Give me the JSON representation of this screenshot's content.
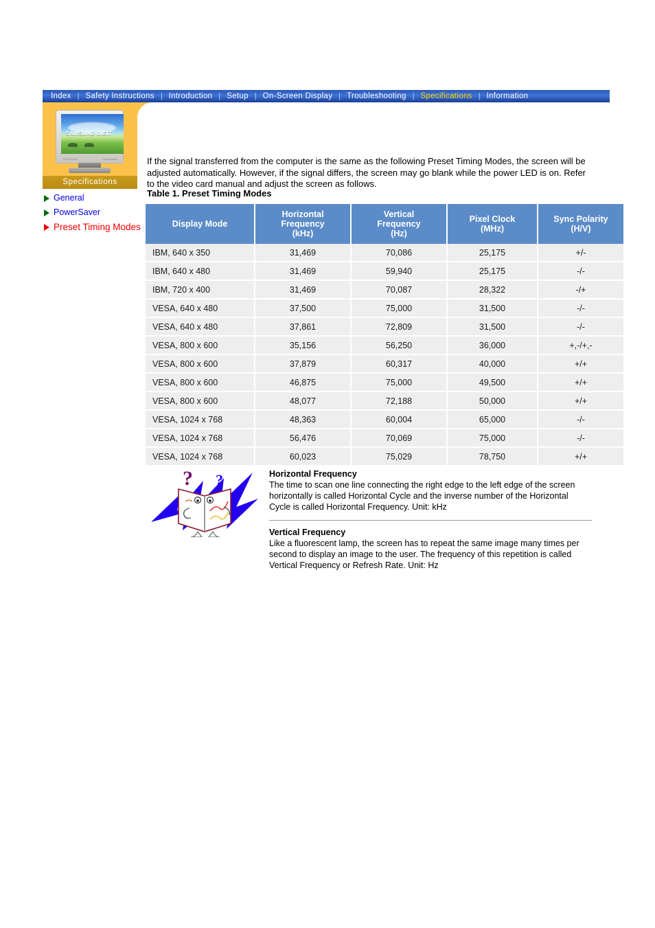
{
  "nav": {
    "items": [
      {
        "label": "Index",
        "active": false
      },
      {
        "label": "Safety Instructions",
        "active": false
      },
      {
        "label": "Introduction",
        "active": false
      },
      {
        "label": "Setup",
        "active": false
      },
      {
        "label": "On-Screen Display",
        "active": false
      },
      {
        "label": "Troubleshooting",
        "active": false
      },
      {
        "label": "Specifications",
        "active": true
      },
      {
        "label": "Information",
        "active": false
      }
    ],
    "separator": "|",
    "active_color": "#ffd500",
    "bar_color": "#3f74d8"
  },
  "sidebar": {
    "section_label": "Specifications",
    "thumbnail": {
      "screen_text": "SAMSUNG DIGIT",
      "brand_text": "SAMSUNG",
      "model_text": "SyncMaster"
    },
    "links": [
      {
        "label": "General",
        "current": false
      },
      {
        "label": "PowerSaver",
        "current": false
      },
      {
        "label": "Preset Timing Modes",
        "current": true
      }
    ],
    "link_color": "#0000e0",
    "current_color": "#ee0000",
    "panel_color": "#fbc24a",
    "label_band_color": "#b98c15"
  },
  "main": {
    "intro": "If the signal transferred from the computer is the same as the following Preset Timing Modes, the screen will be adjusted automatically. However, if the signal differs, the screen may go blank while the power LED is on. Refer to the video card manual and adjust the screen as follows.",
    "table_caption": "Table 1. Preset Timing Modes",
    "table": {
      "header_color": "#5b8cc8",
      "row_color": "#eeeeee",
      "columns": [
        "Display Mode",
        "Horizontal Frequency (kHz)",
        "Vertical Frequency (Hz)",
        "Pixel Clock (MHz)",
        "Sync Polarity (H/V)"
      ],
      "columns_lines": [
        [
          "Display Mode"
        ],
        [
          "Horizontal",
          "Frequency",
          "(kHz)"
        ],
        [
          "Vertical",
          "Frequency",
          "(Hz)"
        ],
        [
          "Pixel Clock",
          "(MHz)"
        ],
        [
          "Sync Polarity",
          "(H/V)"
        ]
      ],
      "rows": [
        {
          "mode": "IBM, 640 x 350",
          "hfreq": "31,469",
          "vfreq": "70,086",
          "pclock": "25,175",
          "sync": "+/-"
        },
        {
          "mode": "IBM, 640 x 480",
          "hfreq": "31,469",
          "vfreq": "59,940",
          "pclock": "25,175",
          "sync": "-/-"
        },
        {
          "mode": "IBM, 720 x 400",
          "hfreq": "31,469",
          "vfreq": "70,087",
          "pclock": "28,322",
          "sync": "-/+"
        },
        {
          "mode": "VESA, 640 x 480",
          "hfreq": "37,500",
          "vfreq": "75,000",
          "pclock": "31,500",
          "sync": "-/-"
        },
        {
          "mode": "VESA, 640 x 480",
          "hfreq": "37,861",
          "vfreq": "72,809",
          "pclock": "31,500",
          "sync": "-/-"
        },
        {
          "mode": "VESA, 800 x 600",
          "hfreq": "35,156",
          "vfreq": "56,250",
          "pclock": "36,000",
          "sync": "+,-/+,-"
        },
        {
          "mode": "VESA, 800 x 600",
          "hfreq": "37,879",
          "vfreq": "60,317",
          "pclock": "40,000",
          "sync": "+/+"
        },
        {
          "mode": "VESA, 800 x 600",
          "hfreq": "46,875",
          "vfreq": "75,000",
          "pclock": "49,500",
          "sync": "+/+"
        },
        {
          "mode": "VESA, 800 x 600",
          "hfreq": "48,077",
          "vfreq": "72,188",
          "pclock": "50,000",
          "sync": "+/+"
        },
        {
          "mode": "VESA, 1024 x 768",
          "hfreq": "48,363",
          "vfreq": "60,004",
          "pclock": "65,000",
          "sync": "-/-"
        },
        {
          "mode": "VESA, 1024 x 768",
          "hfreq": "56,476",
          "vfreq": "70,069",
          "pclock": "75,000",
          "sync": "-/-"
        },
        {
          "mode": "VESA, 1024 x 768",
          "hfreq": "60,023",
          "vfreq": "75,029",
          "pclock": "78,750",
          "sync": "+/+"
        }
      ]
    },
    "notes": [
      {
        "title": "Horizontal Frequency",
        "body": "The time to scan one line connecting the right edge to the left edge of the screen horizontally is called Horizontal Cycle and the inverse number of the Horizontal Cycle is called Horizontal Frequency. Unit: kHz"
      },
      {
        "title": "Vertical Frequency",
        "body": "Like a fluorescent lamp, the screen has to repeat the same image many times per second to display an image to the user. The frequency of this repetition is called Vertical Frequency or Refresh Rate. Unit: Hz"
      }
    ]
  }
}
